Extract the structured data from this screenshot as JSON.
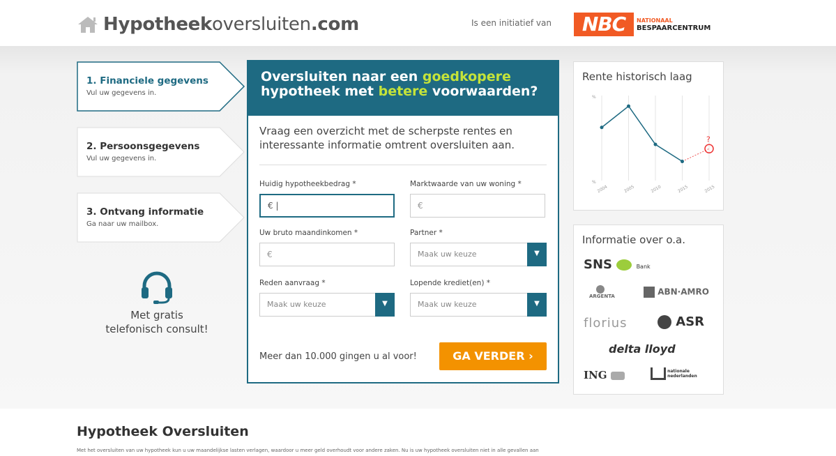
{
  "header": {
    "logo_bold": "Hypotheek",
    "logo_light": "oversluiten",
    "logo_tld": ".com",
    "initiative_text": "Is een initiatief van",
    "nbc_abbr": "NBC",
    "nbc_line1": "NATIONAAL",
    "nbc_line2": "BESPAARCENTRUM",
    "home_icon": "home-icon"
  },
  "steps": [
    {
      "title": "1. Financiele gegevens",
      "sub": "Vul uw gegevens in."
    },
    {
      "title": "2. Persoonsgegevens",
      "sub": "Vul uw gegevens in."
    },
    {
      "title": "3. Ontvang informatie",
      "sub": "Ga naar uw mailbox."
    }
  ],
  "consult": {
    "icon": "headset-icon",
    "line1": "Met gratis",
    "line2": "telefonisch consult!"
  },
  "form": {
    "heading_1": "Oversluiten naar een ",
    "heading_hl1": "goedkopere",
    "heading_2": "hypotheek met ",
    "heading_hl2": "betere",
    "heading_3": " voorwaarden?",
    "intro": "Vraag een overzicht met de scherpste rentes en interessante informatie omtrent oversluiten aan.",
    "fields": {
      "mortgage_label": "Huidig hypotheekbedrag *",
      "mortgage_value": "€ |",
      "market_label": "Marktwaarde van uw woning *",
      "market_value": "€",
      "income_label": "Uw bruto maandinkomen *",
      "income_value": "€",
      "partner_label": "Partner *",
      "partner_value": "Maak uw keuze",
      "reason_label": "Reden aanvraag *",
      "reason_value": "Maak uw keuze",
      "credit_label": "Lopende krediet(en) *",
      "credit_value": "Maak uw keuze"
    },
    "cta_text": "Meer dan 10.000 gingen u al voor!",
    "cta_button": "GA VERDER  ›",
    "accent": "#1e6a82",
    "highlight": "#c4e33a",
    "button_color": "#f39200"
  },
  "rate_card": {
    "title": "Rente historisch laag",
    "question_mark": "?",
    "y_label_top": "%",
    "y_label_bottom": "%",
    "chart_data": {
      "type": "line",
      "categories": [
        "2004",
        "2005",
        "2010",
        "2015",
        "2015"
      ],
      "values": [
        6.0,
        7.0,
        5.2,
        4.4,
        5.0
      ]
    }
  },
  "partners_card": {
    "title": "Informatie over o.a.",
    "logos": [
      "SNS",
      "Bank",
      "ARGENTA",
      "ABN·AMRO",
      "florius",
      "ASR",
      "delta lloyd",
      "ING",
      "nationale nederlanden"
    ]
  },
  "bottom": {
    "title": "Hypotheek Oversluiten",
    "text": "Met het oversluiten van uw hypotheek kun u uw maandelijkse lasten verlagen, waardoor u meer geld overhoudt voor andere zaken. Nu is uw hypotheek oversluiten niet in alle gevallen aan"
  }
}
